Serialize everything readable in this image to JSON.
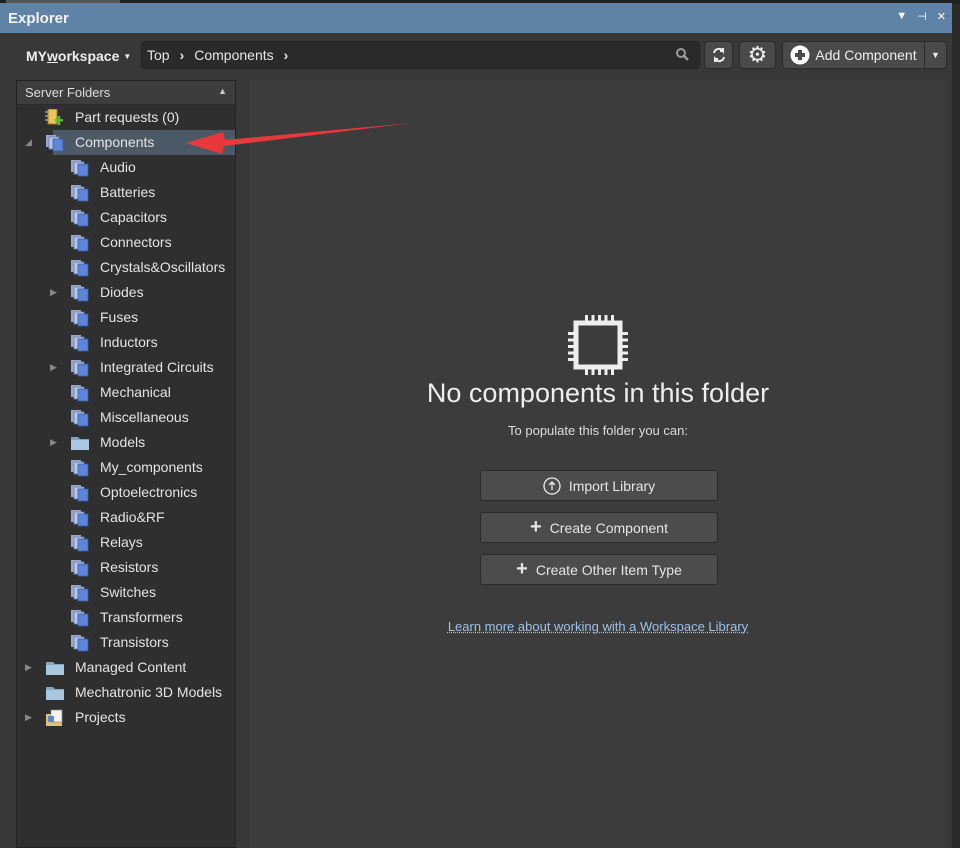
{
  "window": {
    "title": "Explorer"
  },
  "toolbar": {
    "workspace_prefix": "MY",
    "workspace_underlined": "w",
    "workspace_rest": "orkspace",
    "breadcrumb": [
      "Top",
      "Components"
    ],
    "add_component_label": "Add Component"
  },
  "tree": {
    "header": "Server Folders",
    "items": [
      {
        "label": "Part requests (0)",
        "level": 0,
        "icon": "part-request-icon",
        "expander": ""
      },
      {
        "label": "Components",
        "level": 0,
        "icon": "components-icon",
        "expander": "expanded",
        "selected": true
      },
      {
        "label": "Audio",
        "level": 1,
        "icon": "components-icon",
        "expander": ""
      },
      {
        "label": "Batteries",
        "level": 1,
        "icon": "components-icon",
        "expander": ""
      },
      {
        "label": "Capacitors",
        "level": 1,
        "icon": "components-icon",
        "expander": ""
      },
      {
        "label": "Connectors",
        "level": 1,
        "icon": "components-icon",
        "expander": ""
      },
      {
        "label": "Crystals&Oscillators",
        "level": 1,
        "icon": "components-icon",
        "expander": ""
      },
      {
        "label": "Diodes",
        "level": 1,
        "icon": "components-icon",
        "expander": "collapsed"
      },
      {
        "label": "Fuses",
        "level": 1,
        "icon": "components-icon",
        "expander": ""
      },
      {
        "label": "Inductors",
        "level": 1,
        "icon": "components-icon",
        "expander": ""
      },
      {
        "label": "Integrated Circuits",
        "level": 1,
        "icon": "components-icon",
        "expander": "collapsed"
      },
      {
        "label": "Mechanical",
        "level": 1,
        "icon": "components-icon",
        "expander": ""
      },
      {
        "label": "Miscellaneous",
        "level": 1,
        "icon": "components-icon",
        "expander": ""
      },
      {
        "label": "Models",
        "level": 1,
        "icon": "folder-icon",
        "expander": "collapsed"
      },
      {
        "label": "My_components",
        "level": 1,
        "icon": "components-icon",
        "expander": ""
      },
      {
        "label": "Optoelectronics",
        "level": 1,
        "icon": "components-icon",
        "expander": ""
      },
      {
        "label": "Radio&RF",
        "level": 1,
        "icon": "components-icon",
        "expander": ""
      },
      {
        "label": "Relays",
        "level": 1,
        "icon": "components-icon",
        "expander": ""
      },
      {
        "label": "Resistors",
        "level": 1,
        "icon": "components-icon",
        "expander": ""
      },
      {
        "label": "Switches",
        "level": 1,
        "icon": "components-icon",
        "expander": ""
      },
      {
        "label": "Transformers",
        "level": 1,
        "icon": "components-icon",
        "expander": ""
      },
      {
        "label": "Transistors",
        "level": 1,
        "icon": "components-icon",
        "expander": ""
      },
      {
        "label": "Managed Content",
        "level": 0,
        "icon": "folder-icon",
        "expander": "collapsed"
      },
      {
        "label": "Mechatronic 3D Models",
        "level": 0,
        "icon": "folder-icon",
        "expander": ""
      },
      {
        "label": "Projects",
        "level": 0,
        "icon": "projects-icon",
        "expander": "collapsed"
      }
    ]
  },
  "main": {
    "empty_title": "No components in this folder",
    "empty_subtitle": "To populate this folder you can:",
    "actions": [
      {
        "label": "Import Library",
        "icon": "upload-circle-icon"
      },
      {
        "label": "Create Component",
        "icon": "plus-icon"
      },
      {
        "label": "Create Other Item Type",
        "icon": "plus-icon"
      }
    ],
    "learn_more": "Learn more about working with a Workspace Library"
  },
  "colors": {
    "titlebar": "#5f83a6",
    "selection": "#4b5866",
    "arrow": "#e8383b",
    "link": "#9cc2e8"
  }
}
